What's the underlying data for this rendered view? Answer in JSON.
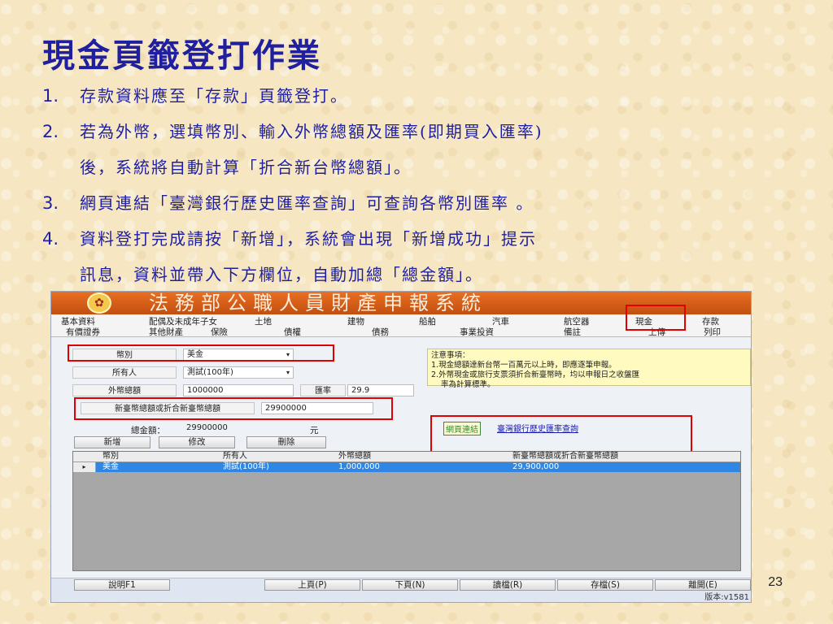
{
  "slide": {
    "title": "現金頁籤登打作業",
    "points": [
      {
        "num": "1.",
        "lines": [
          "存款資料應至「存款」頁籤登打。"
        ]
      },
      {
        "num": "2.",
        "lines": [
          "若為外幣，選填幣別、輸入外幣總額及匯率(即期買入匯率)",
          "後，系統將自動計算「折合新台幣總額」。"
        ]
      },
      {
        "num": "3.",
        "lines": [
          "網頁連結「臺灣銀行歷史匯率查詢」可查詢各幣別匯率 。"
        ]
      },
      {
        "num": "4.",
        "lines": [
          "資料登打完成請按「新增」，系統會出現「新增成功」提示",
          "訊息，資料並帶入下方欄位，自動加總「總金額」。"
        ]
      }
    ],
    "page_number": "23"
  },
  "app": {
    "banner_title": "法務部公職人員財產申報系統",
    "emblem_glyph": "✿",
    "menu_row1": [
      "基本資料",
      "配偶及未成年子女",
      "土地",
      "建物",
      "船舶",
      "汽車",
      "航空器",
      "現金",
      "存款"
    ],
    "menu_row2": [
      "有價證券",
      "其他財產",
      "保險",
      "債權",
      "債務",
      "事業投資",
      "備註",
      "上傳",
      "列印"
    ],
    "form": {
      "currency_label": "幣別",
      "currency_value": "美金",
      "owner_label": "所有人",
      "owner_value": "測試(100年)",
      "foreign_total_label": "外幣總額",
      "foreign_total_value": "1000000",
      "rate_label": "匯率",
      "rate_value": "29.9",
      "twd_total_label": "新臺幣總額或折合新臺幣總額",
      "twd_total_value": "29900000",
      "grand_total_label": "總金額：",
      "grand_total_value": "29900000",
      "grand_total_unit": "元"
    },
    "notice": {
      "title": "注意事項：",
      "items": [
        "1.現金總額達新台幣一百萬元以上時，即應逐筆申報。",
        "2.外幣現金或旅行支票須折合新臺幣時，均以申報日之收盤匯",
        "率為計算標準。"
      ]
    },
    "link_tag": "網頁連結",
    "link_text": "臺灣銀行歷史匯率查詢",
    "buttons": {
      "add": "新增",
      "edit": "修改",
      "delete": "刪除"
    },
    "grid": {
      "headers": [
        "幣別",
        "所有人",
        "外幣總額",
        "新臺幣總額或折合新臺幣總額"
      ],
      "row": [
        "美金",
        "測試(100年)",
        "1,000,000",
        "29,900,000"
      ],
      "row_marker": "▸"
    },
    "status_buttons": [
      "說明F1",
      "上頁(P)",
      "下頁(N)",
      "讀檔(R)",
      "存檔(S)",
      "離開(E)"
    ],
    "version": "版本:v1581",
    "colors": {
      "banner": "#e96f22",
      "highlight": "#e00000",
      "selected_row": "#2f86e3",
      "title": "#1f1fa0"
    }
  }
}
